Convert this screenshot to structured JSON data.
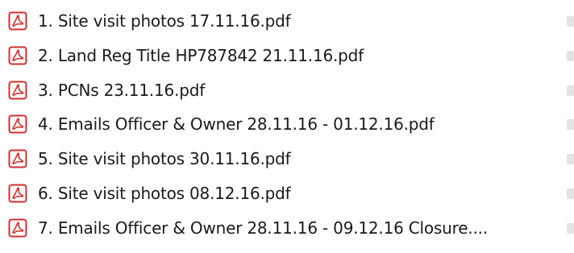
{
  "files": [
    {
      "name": "1. Site visit photos 17.11.16.pdf",
      "icon": "pdf-icon"
    },
    {
      "name": "2. Land Reg Title HP787842 21.11.16.pdf",
      "icon": "pdf-icon"
    },
    {
      "name": "3. PCNs 23.11.16.pdf",
      "icon": "pdf-icon"
    },
    {
      "name": "4. Emails Officer & Owner 28.11.16 - 01.12.16.pdf",
      "icon": "pdf-icon"
    },
    {
      "name": "5. Site visit photos 30.11.16.pdf",
      "icon": "pdf-icon"
    },
    {
      "name": "6. Site visit photos 08.12.16.pdf",
      "icon": "pdf-icon"
    },
    {
      "name": "7. Emails Officer & Owner 28.11.16 - 09.12.16 Closure....",
      "icon": "pdf-icon"
    }
  ],
  "colors": {
    "pdf_red": "#d32f2f",
    "text": "#1a1a1a"
  }
}
